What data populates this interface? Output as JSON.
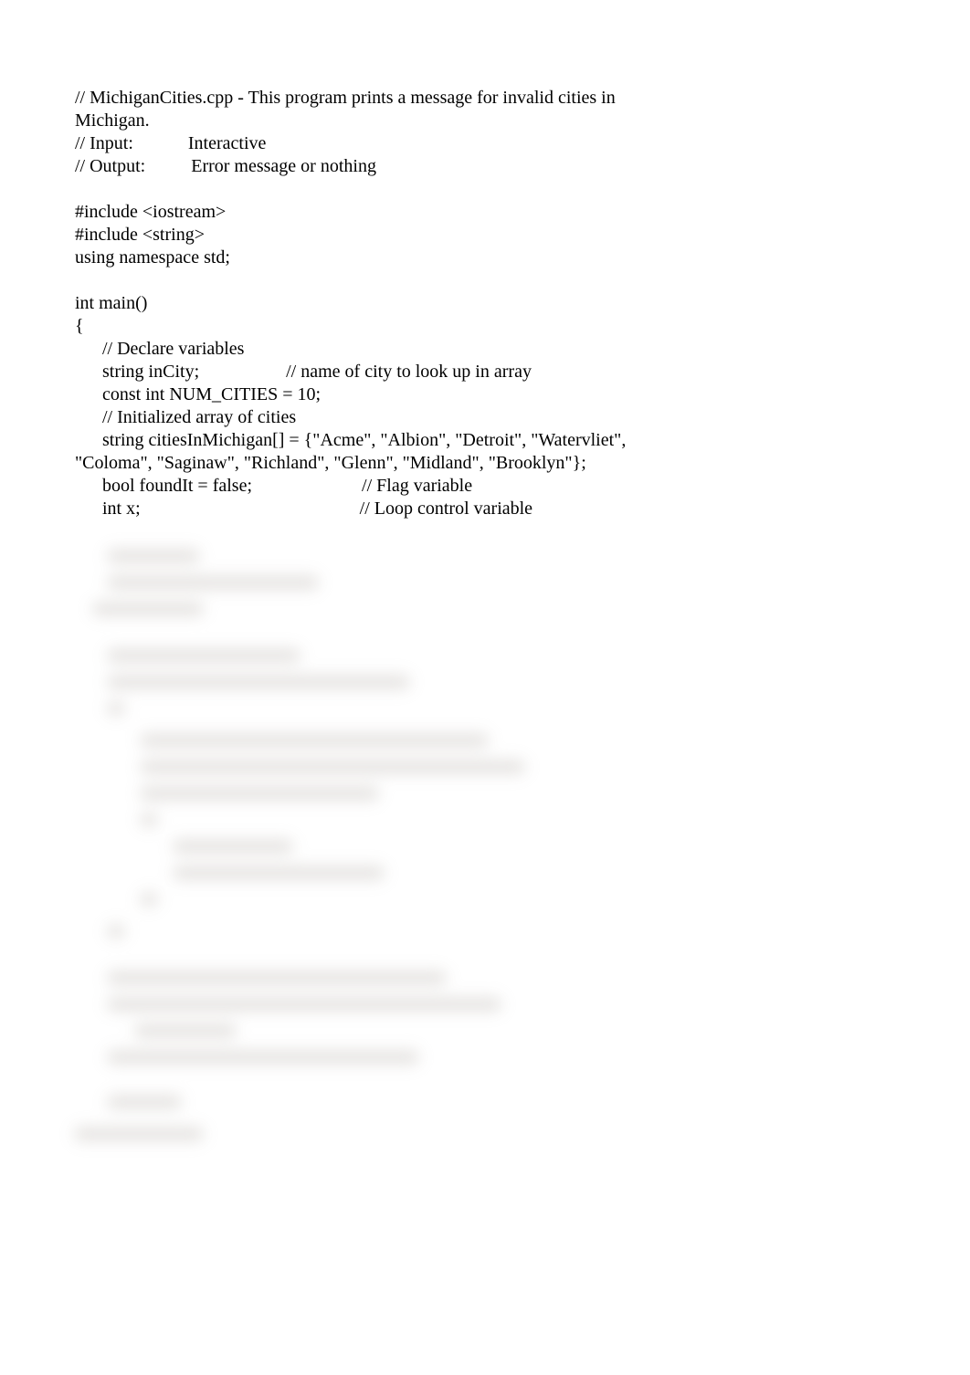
{
  "code": {
    "l1": "// MichiganCities.cpp - This program prints a message for invalid cities in",
    "l2": "Michigan.",
    "l3": "// Input:            Interactive",
    "l4": "// Output:          Error message or nothing",
    "l5": "",
    "l6": "#include <iostream>",
    "l7": "#include <string>",
    "l8": "using namespace std;",
    "l9": "",
    "l10": "int main()",
    "l11": "{",
    "l12": "      // Declare variables",
    "l13": "      string inCity;                   // name of city to look up in array",
    "l14": "      const int NUM_CITIES = 10;",
    "l15": "      // Initialized array of cities",
    "l16": "      string citiesInMichigan[] = {\"Acme\", \"Albion\", \"Detroit\", \"Watervliet\",",
    "l17": "\"Coloma\", \"Saginaw\", \"Richland\", \"Glenn\", \"Midland\", \"Brooklyn\"};",
    "l18": "      bool foundIt = false;                        // Flag variable",
    "l19": "      int x;                                                // Loop control variable"
  }
}
